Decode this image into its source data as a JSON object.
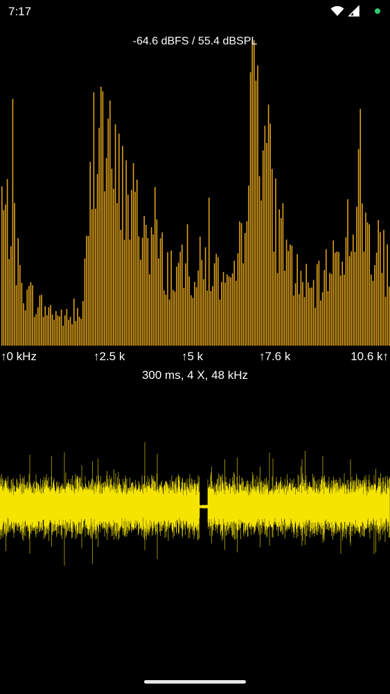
{
  "status_bar": {
    "time": "7:17",
    "icons": [
      "wifi-icon",
      "signal-icon",
      "privacy-indicator-dot"
    ],
    "privacy_dot_color": "#2ecc71"
  },
  "spectrum": {
    "level_readout": "-64.6 dBFS / 55.4 dBSPL",
    "bar_color": "#e0a21a",
    "axis_labels": [
      "↑0 kHz",
      "↑2.5 k",
      "↑5 k",
      "↑7.6 k",
      "10.6 k↑"
    ]
  },
  "oscilloscope": {
    "info": "300 ms, 4 X, 48 kHz",
    "wave_color": "#f5e400"
  }
}
